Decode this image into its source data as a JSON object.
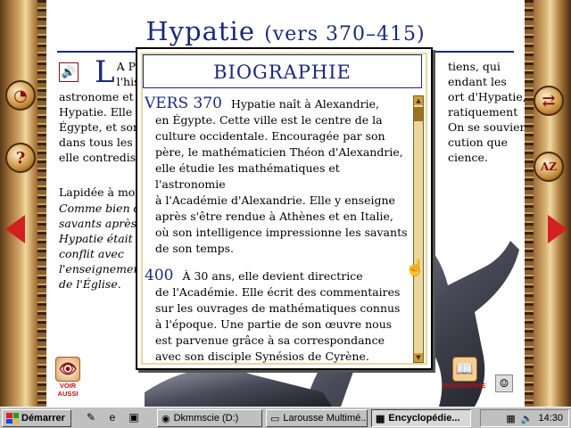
{
  "page": {
    "title_main": "Hypatie",
    "title_dates": "(vers 370–415)",
    "left_col": [
      "A PRE",
      "l'hist",
      "astronome et r",
      "Hypatie. Elle v",
      "Égypte, et son",
      "dans tous les p",
      "elle contredisai"
    ],
    "right_col": [
      "tiens, qui",
      "endant les",
      "ort d'Hypatie,",
      "ratiquement",
      "On se souvient",
      "cution que",
      "cience."
    ],
    "dropcap": "L",
    "sub_head": "Lapidée à mor",
    "italic_lines": [
      "Comme bien d",
      "savants après e",
      "Hypatie était e",
      "conflit avec",
      "l'enseignement",
      "de l'Église."
    ]
  },
  "popup": {
    "title": "Biographie",
    "entries": [
      {
        "year": "vers 370",
        "lines": [
          "Hypatie naît à Alexandrie,",
          "en Égypte. Cette ville est le centre de la",
          "culture occidentale. Encouragée par son",
          "père, le mathématicien Théon d'Alexandrie,",
          "elle étudie les mathématiques et l'astronomie",
          "à l'Académie d'Alexandrie. Elle y enseigne",
          "après s'être rendue à Athènes et en Italie,",
          "où son intelligence impressionne les savants",
          "de son temps."
        ]
      },
      {
        "year": "400",
        "lines": [
          "À 30 ans, elle devient directrice",
          "de l'Académie. Elle écrit des commentaires",
          "sur les ouvrages de mathématiques connus",
          "à l'époque. Une partie de son œuvre nous",
          "est parvenue grâce à sa correspondance",
          "avec son disciple Synésios de Cyrène."
        ]
      }
    ]
  },
  "buttons": {
    "voir_label_1": "VOIR",
    "voir_label_2": "AUSSI",
    "bio_label": "BIOGRAPHIE"
  },
  "taskbar": {
    "start": "Démarrer",
    "tasks": [
      {
        "label": "Dkmmscie (D:)",
        "icon": "drive-icon"
      },
      {
        "label": "Larousse Multimé...",
        "icon": "folder-icon"
      },
      {
        "label": "Encyclopédie...",
        "icon": "app-icon"
      }
    ],
    "clock": "14:30"
  },
  "colors": {
    "title_blue": "#1a2a7a",
    "accent_red": "#c01010"
  }
}
